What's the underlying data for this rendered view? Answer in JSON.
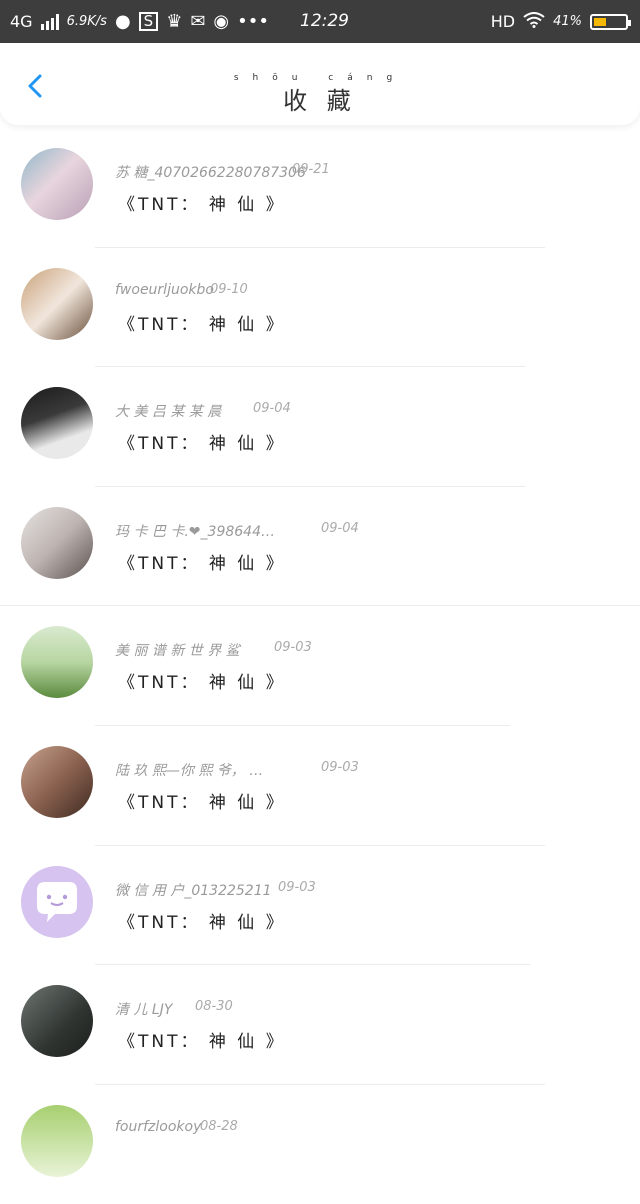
{
  "status_bar": {
    "network": "4G",
    "speed": "6.9K/s",
    "time": "12:29",
    "hd": "HD",
    "battery": "41%",
    "battery_level": 0.41,
    "icons": [
      "signal-icon",
      "planet-icon",
      "s-icon",
      "crown-icon",
      "mail-icon",
      "palette-icon",
      "more-icon",
      "wifi-icon",
      "battery-icon"
    ]
  },
  "header": {
    "title": "收 藏",
    "pinyin": "shōu cáng",
    "back_icon": "chevron-left-icon",
    "accent": "#2196f3"
  },
  "items": [
    {
      "user": "苏 糖_40702662280787306",
      "date": "09-21",
      "content": "《TNT：  神 仙 》",
      "avatar": {
        "bg": "linear-gradient(135deg,#8fb7c9,#e8d5dd 45%,#b8a0b6)"
      }
    },
    {
      "user": "fwoeurljuokbo",
      "date": "09-10",
      "content": "《TNT：  神 仙 》",
      "avatar": {
        "bg": "linear-gradient(135deg,#c9a27a,#f1e6dc 50%,#6b4f3a)"
      }
    },
    {
      "user": "大 美 吕 某 某 晨",
      "date": "09-04",
      "content": "《TNT：  神 仙 》",
      "avatar": {
        "bg": "linear-gradient(160deg,#1a1a1a,#3a3a3a 40%,#e9e9e9 70%)"
      }
    },
    {
      "user": "玛 卡 巴 卡.❤_398644…",
      "date": "09-04",
      "content": "《TNT：  神 仙 》",
      "avatar": {
        "bg": "linear-gradient(135deg,#e6e2e0,#bdb4b1 50%,#5b5250)"
      }
    },
    {
      "user": "美 丽 谱 新 世 界 鲨",
      "date": "09-03",
      "content": "《TNT：  神 仙 》",
      "avatar": {
        "bg": "linear-gradient(180deg,#d9ead0,#b8d6a2 50%,#5b8a3e)"
      }
    },
    {
      "user": "陆 玖 熙—你 熙 爷，  …",
      "date": "09-03",
      "content": "《TNT：  神 仙 》",
      "avatar": {
        "bg": "linear-gradient(135deg,#c7a28d,#8b6250 50%,#3f2a22)"
      }
    },
    {
      "user": "微 信 用 户_013225211",
      "date": "09-03",
      "content": "《TNT：  神 仙 》",
      "avatar": {
        "bg": "#d6c3f0"
      }
    },
    {
      "user": "清 儿 LJY",
      "date": "08-30",
      "content": "《TNT：  神 仙 》",
      "avatar": {
        "bg": "linear-gradient(135deg,#6f7773,#2f3431 60%,#1c1f1d)"
      }
    },
    {
      "user": "fourfzlookoy",
      "date": "08-28",
      "content": "",
      "avatar": {
        "bg": "linear-gradient(180deg,#a7cf6f,#e8f3d7)"
      }
    }
  ]
}
